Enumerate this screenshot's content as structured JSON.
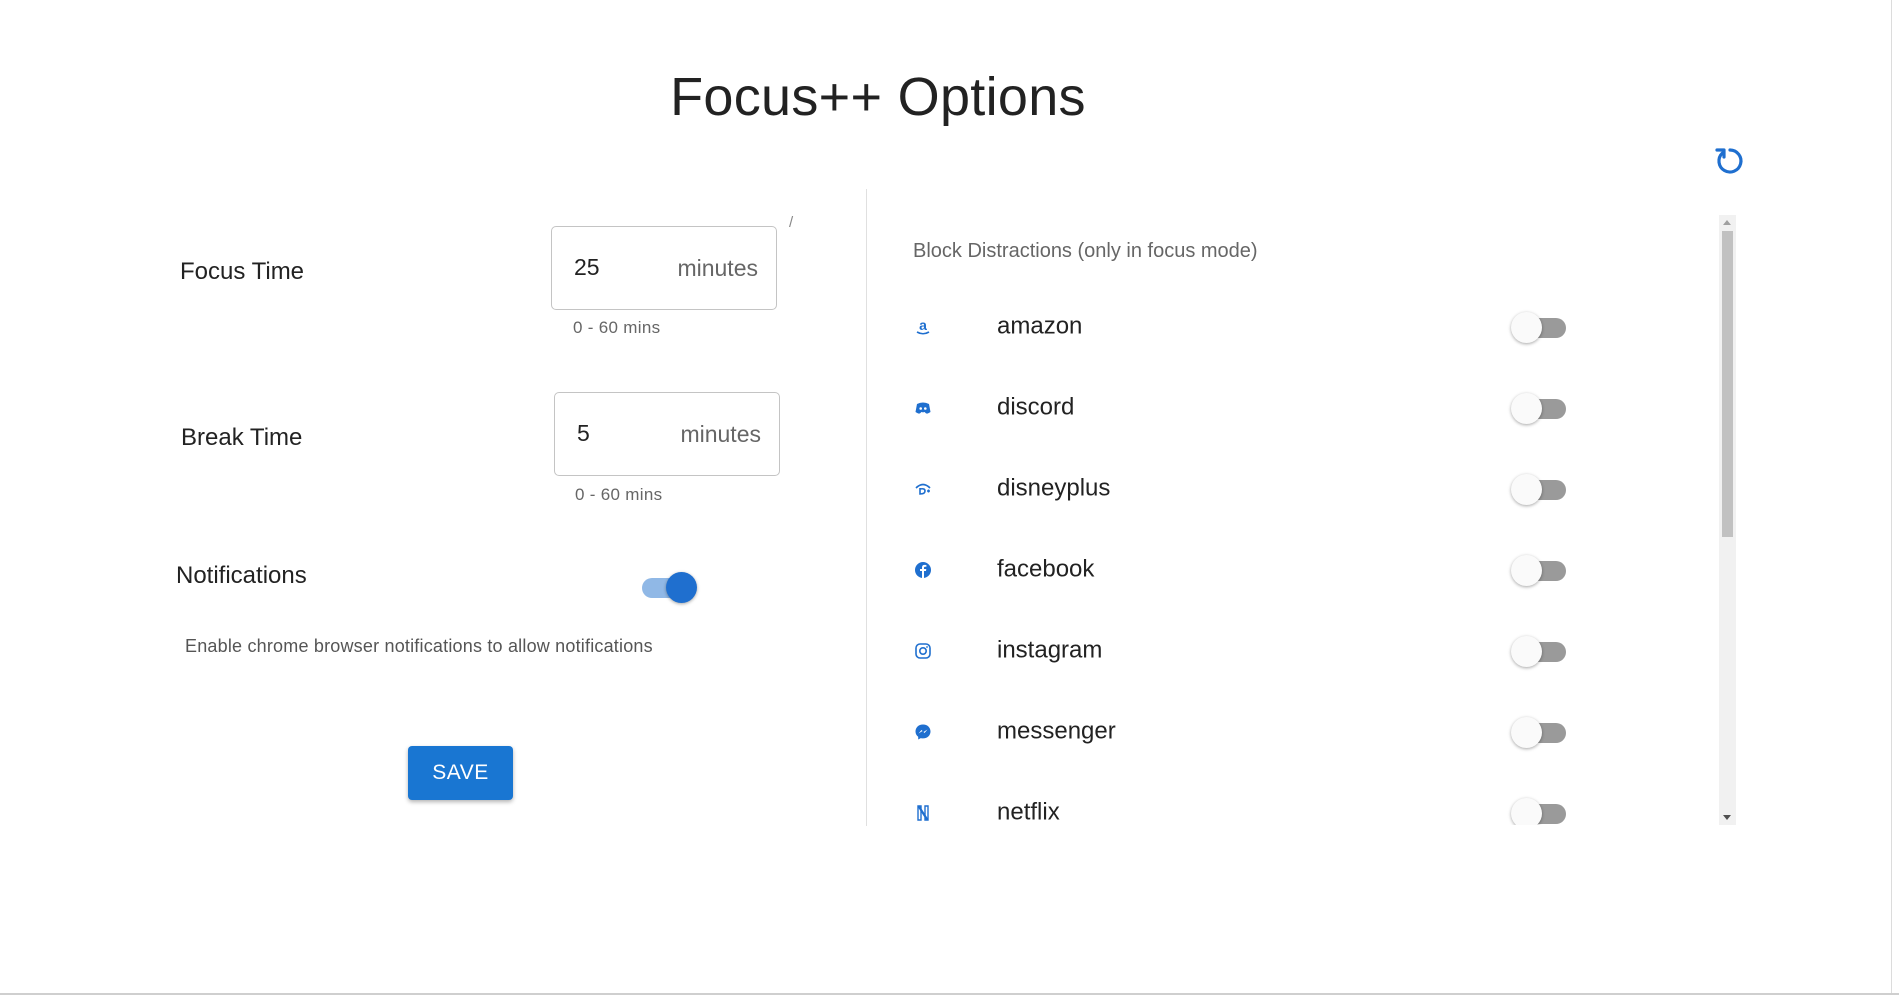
{
  "page": {
    "title": "Focus++ Options"
  },
  "colors": {
    "accent": "#1976d2",
    "toggle_on": "#1f6fcf",
    "toggle_off_track": "#9a9a9a"
  },
  "reset": {
    "icon": "reset-icon"
  },
  "focus_time": {
    "label": "Focus Time",
    "value": "25",
    "unit": "minutes",
    "helper": "0 - 60 mins"
  },
  "break_time": {
    "label": "Break Time",
    "value": "5",
    "unit": "minutes",
    "helper": "0 - 60 mins"
  },
  "slash_mark": "/",
  "notifications": {
    "label": "Notifications",
    "enabled": true,
    "helper": "Enable chrome browser notifications to allow notifications"
  },
  "save": {
    "label": "SAVE"
  },
  "block": {
    "heading": "Block Distractions (only in focus mode)",
    "sites": [
      {
        "name": "amazon",
        "icon": "amazon-icon",
        "enabled": false
      },
      {
        "name": "discord",
        "icon": "discord-icon",
        "enabled": false
      },
      {
        "name": "disneyplus",
        "icon": "disneyplus-icon",
        "enabled": false
      },
      {
        "name": "facebook",
        "icon": "facebook-icon",
        "enabled": false
      },
      {
        "name": "instagram",
        "icon": "instagram-icon",
        "enabled": false
      },
      {
        "name": "messenger",
        "icon": "messenger-icon",
        "enabled": false
      },
      {
        "name": "netflix",
        "icon": "netflix-icon",
        "enabled": false
      }
    ]
  }
}
